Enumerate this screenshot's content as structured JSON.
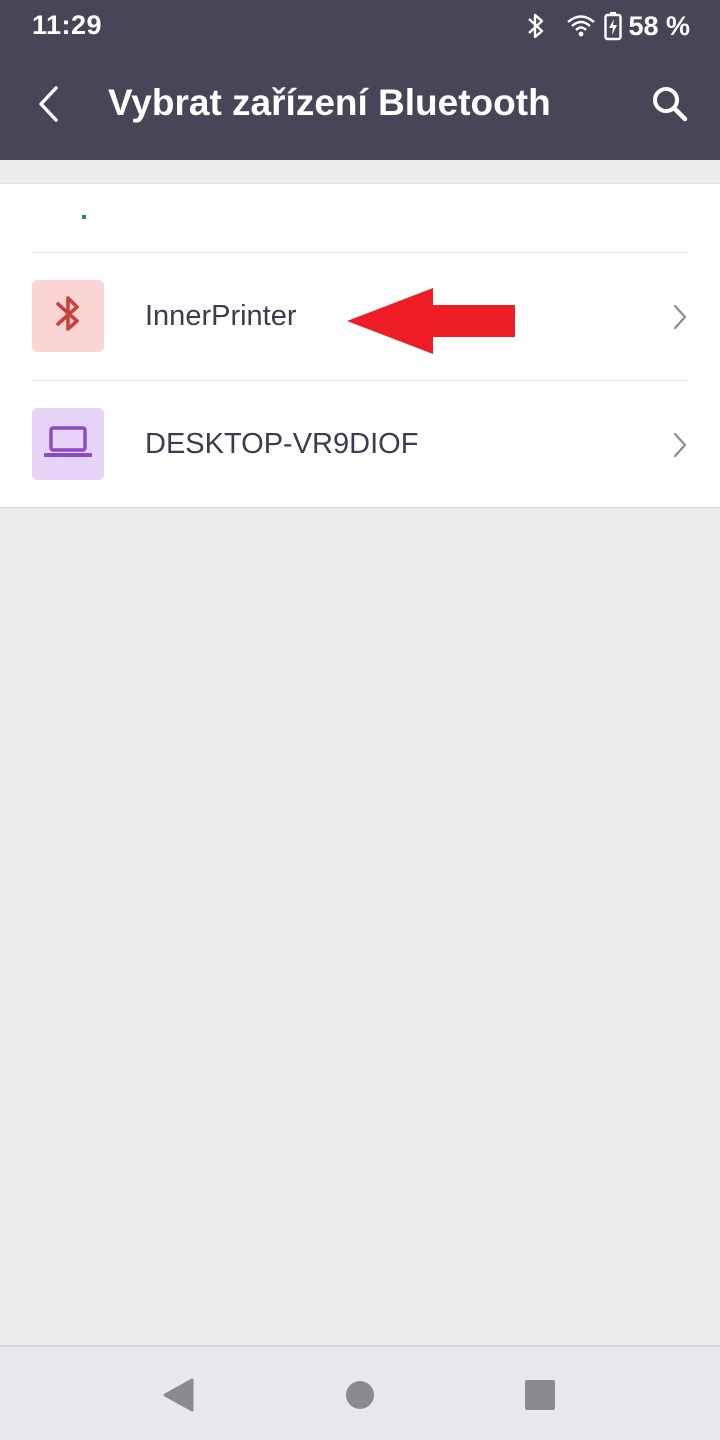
{
  "status_bar": {
    "time": "11:29",
    "battery_text": "58 %",
    "icons": [
      "bluetooth-icon",
      "wifi-icon",
      "battery-charging-icon"
    ]
  },
  "app_bar": {
    "title": "Vybrat zařízení Bluetooth",
    "back_icon": "chevron-left-icon",
    "search_icon": "search-icon"
  },
  "devices": [
    {
      "name": "InnerPrinter",
      "icon": "bluetooth-icon",
      "icon_bg": "#fbd5d3",
      "icon_color": "#c9413d"
    },
    {
      "name": "DESKTOP-VR9DIOF",
      "icon": "laptop-icon",
      "icon_bg": "#e8d3f8",
      "icon_color": "#8a4bc4"
    }
  ],
  "annotation": {
    "icon": "red-arrow-icon",
    "color": "#ee1c25"
  },
  "nav_bar": {
    "icons": [
      "nav-back-icon",
      "nav-home-icon",
      "nav-recents-icon"
    ]
  },
  "colors": {
    "app_bar_bg": "#464658",
    "page_bg": "#ececef",
    "text_primary": "#3a3d4f"
  }
}
